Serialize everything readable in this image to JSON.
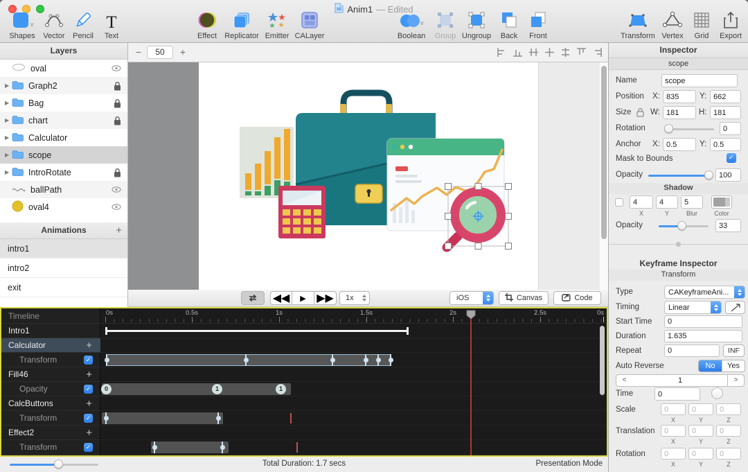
{
  "window": {
    "title": "Anim1",
    "edited": "— Edited"
  },
  "toolbar": {
    "shapes": "Shapes",
    "vector": "Vector",
    "pencil": "Pencil",
    "text": "Text",
    "effect": "Effect",
    "replicator": "Replicator",
    "emitter": "Emitter",
    "calayer": "CALayer",
    "boolean": "Boolean",
    "group": "Group",
    "ungroup": "Ungroup",
    "back": "Back",
    "front": "Front",
    "transform": "Transform",
    "vertex": "Vertex",
    "grid": "Grid",
    "export": "Export"
  },
  "layers": {
    "title": "Layers",
    "items": [
      {
        "name": "oval"
      },
      {
        "name": "Graph2"
      },
      {
        "name": "Bag"
      },
      {
        "name": "chart"
      },
      {
        "name": "Calculator"
      },
      {
        "name": "scope"
      },
      {
        "name": "IntroRotate"
      },
      {
        "name": "ballPath"
      },
      {
        "name": "oval4"
      }
    ]
  },
  "animations": {
    "title": "Animations",
    "add": "+",
    "items": [
      "intro1",
      "intro2",
      "exit"
    ]
  },
  "canvas_bar": {
    "minus": "−",
    "zoom": "50",
    "plus": "+"
  },
  "playback": {
    "speed": "1x",
    "platform": "iOS",
    "canvas": "Canvas",
    "code": "Code"
  },
  "inspector": {
    "title": "Inspector",
    "selection": "scope",
    "name_label": "Name",
    "name": "scope",
    "position_label": "Position",
    "x_label": "X:",
    "y_label": "Y:",
    "position_x": "835",
    "position_y": "662",
    "size_label": "Size",
    "w_label": "W:",
    "h_label": "H:",
    "size_w": "181",
    "size_h": "181",
    "rotation_label": "Rotation",
    "rotation": "0",
    "anchor_label": "Anchor",
    "anchor_x": "0.5",
    "anchor_y": "0.5",
    "mask_label": "Mask to Bounds",
    "mask_check": "✓",
    "opacity_label": "Opacity",
    "opacity": "100",
    "shadow": {
      "title": "Shadow",
      "x": "4",
      "y": "4",
      "blur": "5",
      "x_label": "X",
      "y_label": "Y",
      "blur_label": "Blur",
      "color_label": "Color",
      "opacity_label": "Opacity",
      "opacity": "33"
    }
  },
  "keyframe": {
    "title": "Keyframe Inspector",
    "subtitle": "Transform",
    "type_label": "Type",
    "type": "CAKeyframeAni...",
    "timing_label": "Timing",
    "timing": "Linear",
    "start_label": "Start Time",
    "start": "0",
    "duration_label": "Duration",
    "duration": "1.635",
    "repeat_label": "Repeat",
    "repeat": "0",
    "inf": "INF",
    "auto_label": "Auto Reverse",
    "no": "No",
    "yes": "Yes",
    "pager_prev": "<",
    "pager_value": "1",
    "pager_next": ">",
    "time_label": "Time",
    "time": "0",
    "scale_label": "Scale",
    "translation_label": "Translation",
    "rotation_label": "Rotation",
    "axis": {
      "x": "X",
      "y": "Y",
      "z": "Z"
    },
    "zero": "0"
  },
  "timeline": {
    "header": "Timeline",
    "ruler": [
      "0s",
      "0.5s",
      "1s",
      "1.5s",
      "2s",
      "2.5s"
    ],
    "ruler_wrap": "0s",
    "rows": [
      {
        "label": "Intro1"
      },
      {
        "label": "Calculator",
        "add": "+"
      },
      {
        "label": "Transform",
        "check": "✓"
      },
      {
        "label": "Fill46",
        "add": "+"
      },
      {
        "label": "Opacity",
        "check": "✓"
      },
      {
        "label": "CalcButtons",
        "add": "+"
      },
      {
        "label": "Transform",
        "check": "✓"
      },
      {
        "label": "Effect2",
        "add": "+"
      },
      {
        "label": "Transform",
        "check": "✓"
      }
    ],
    "opacity_keys": [
      "0",
      "1",
      "1"
    ]
  },
  "status": {
    "duration": "Total Duration: 1.7 secs",
    "mode": "Presentation Mode"
  }
}
